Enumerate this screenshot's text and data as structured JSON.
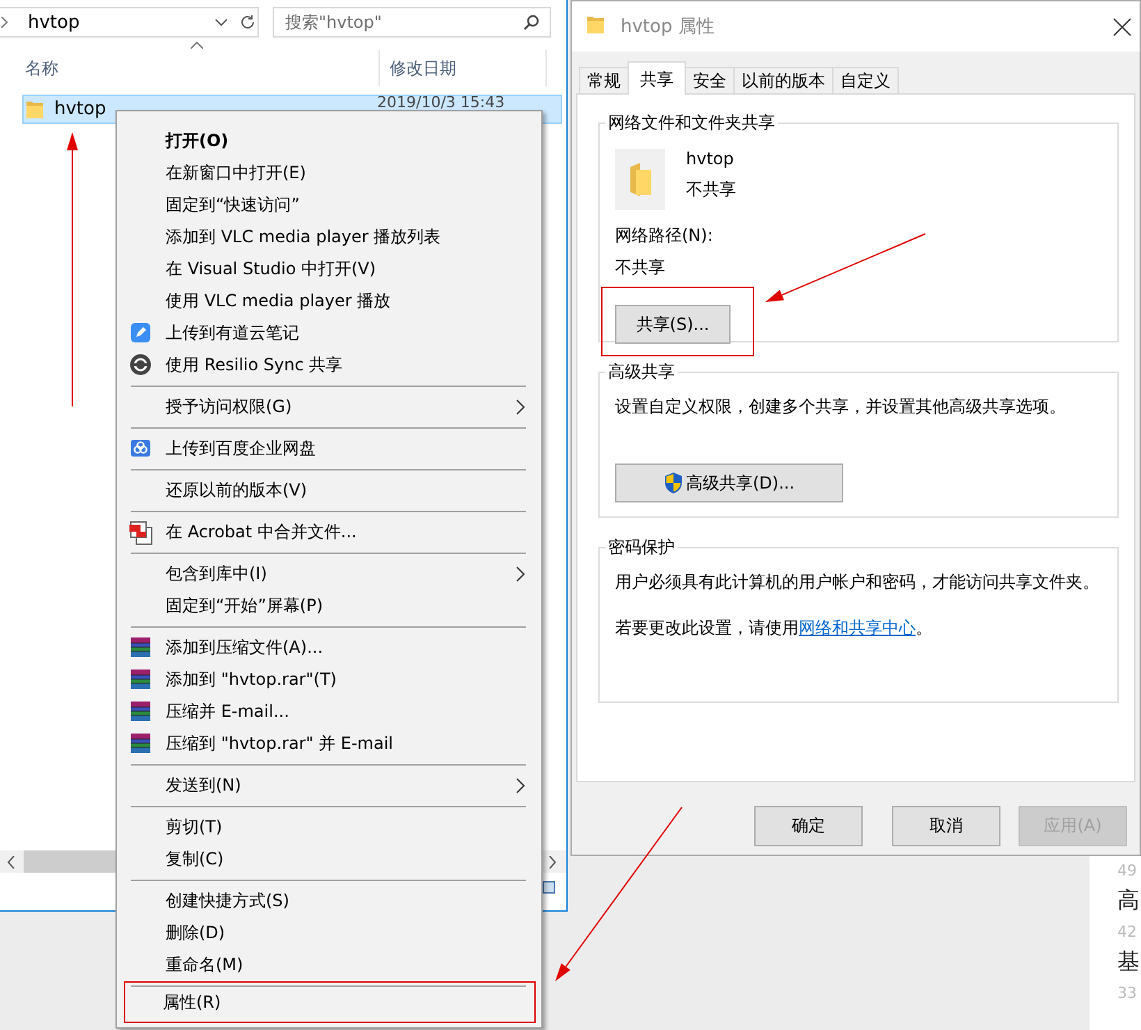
{
  "explorer": {
    "address": "hvtop",
    "search": {
      "placeholder": "搜索\"hvtop\""
    },
    "columns": [
      {
        "label": "名称",
        "sorted": true
      },
      {
        "label": "修改日期",
        "sorted": false
      }
    ],
    "rows": [
      {
        "name": "hvtop",
        "modified": "2019/10/3 15:43",
        "selected": true,
        "annotated": true
      }
    ]
  },
  "context_menu": {
    "items": [
      {
        "kind": "item",
        "label": "打开(O)",
        "default": true
      },
      {
        "kind": "item",
        "label": "在新窗口中打开(E)"
      },
      {
        "kind": "item",
        "label": "固定到“快速访问”"
      },
      {
        "kind": "item",
        "label": "添加到 VLC media player 播放列表"
      },
      {
        "kind": "item",
        "label": "在 Visual Studio 中打开(V)"
      },
      {
        "kind": "item",
        "label": "使用 VLC media player 播放"
      },
      {
        "kind": "note",
        "label": "上传到有道云笔记"
      },
      {
        "kind": "sync",
        "label": "使用 Resilio Sync 共享"
      },
      {
        "kind": "separator"
      },
      {
        "kind": "item",
        "label": "授予访问权限(G)",
        "submenu": true
      },
      {
        "kind": "separator"
      },
      {
        "kind": "cloud",
        "label": "上传到百度企业网盘"
      },
      {
        "kind": "separator"
      },
      {
        "kind": "item",
        "label": "还原以前的版本(V)"
      },
      {
        "kind": "separator"
      },
      {
        "kind": "acrobat",
        "label": "在 Acrobat 中合并文件..."
      },
      {
        "kind": "separator"
      },
      {
        "kind": "item",
        "label": "包含到库中(I)",
        "submenu": true
      },
      {
        "kind": "item",
        "label": "固定到“开始”屏幕(P)"
      },
      {
        "kind": "separator"
      },
      {
        "kind": "archive",
        "label": "添加到压缩文件(A)..."
      },
      {
        "kind": "archive",
        "label": "添加到 \"hvtop.rar\"(T)"
      },
      {
        "kind": "archive",
        "label": "压缩并 E-mail..."
      },
      {
        "kind": "archive",
        "label": "压缩到 \"hvtop.rar\" 并 E-mail"
      },
      {
        "kind": "separator"
      },
      {
        "kind": "item",
        "label": "发送到(N)",
        "submenu": true
      },
      {
        "kind": "separator"
      },
      {
        "kind": "item",
        "label": "剪切(T)"
      },
      {
        "kind": "item",
        "label": "复制(C)"
      },
      {
        "kind": "separator"
      },
      {
        "kind": "item",
        "label": "创建快捷方式(S)"
      },
      {
        "kind": "item",
        "label": "删除(D)"
      },
      {
        "kind": "item",
        "label": "重命名(M)"
      },
      {
        "kind": "separator"
      },
      {
        "kind": "item",
        "label": "属性(R)",
        "annotated": true
      }
    ]
  },
  "properties": {
    "title": "hvtop 属性",
    "tabs": [
      {
        "label": "常规",
        "selected": false
      },
      {
        "label": "共享",
        "selected": true
      },
      {
        "label": "安全",
        "selected": false
      },
      {
        "label": "以前的版本",
        "selected": false
      },
      {
        "label": "自定义",
        "selected": false
      }
    ],
    "sharing": {
      "title": "网络文件和文件夹共享",
      "name": "hvtop",
      "status": "不共享",
      "path_label": "网络路径(N):",
      "path": "不共享",
      "button": {
        "label": "共享(S)...",
        "annotated": true
      }
    },
    "advanced": {
      "title": "高级共享",
      "description": "设置自定义权限，创建多个共享，并设置其他高级共享选项。",
      "button": "高级共享(D)..."
    },
    "password": {
      "title": "密码保护",
      "description": "用户必须具有此计算机的用户帐户和密码，才能访问共享文件夹。",
      "note": "若要更改此设置，请使用",
      "link": "网络和共享中心",
      "note_end": "。"
    },
    "buttons": [
      {
        "label": "确定",
        "disabled": false
      },
      {
        "label": "取消",
        "disabled": false
      },
      {
        "label": "应用(A)",
        "disabled": true
      }
    ]
  },
  "background": {
    "texts": [
      {
        "kind": "meta",
        "text": "49"
      },
      {
        "kind": "title",
        "text": "高"
      },
      {
        "kind": "meta",
        "text": "42"
      },
      {
        "kind": "title",
        "text": "基"
      },
      {
        "kind": "meta",
        "text": "33"
      }
    ]
  }
}
